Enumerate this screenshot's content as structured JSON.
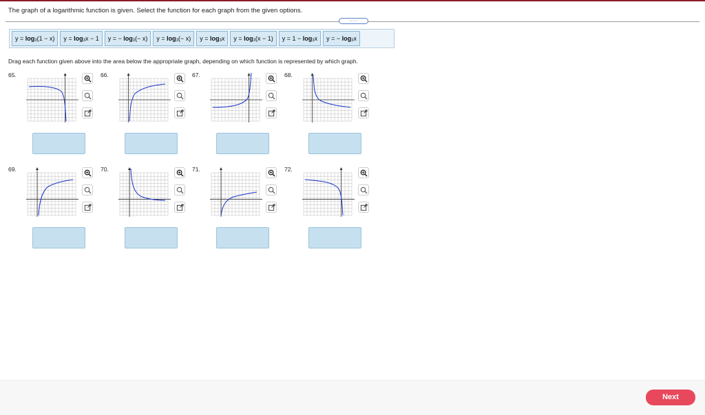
{
  "question": "The graph of a logarithmic function is given. Select the function for each graph from the given options.",
  "more_button": ".....",
  "options": [
    {
      "pre": "y = ",
      "log": "log",
      "base": "3",
      "arg": "(1 − x)",
      "post": ""
    },
    {
      "pre": "y = ",
      "log": "log",
      "base": "3",
      "arg": "x − 1",
      "post": ""
    },
    {
      "pre": "y = − ",
      "log": "log",
      "base": "3",
      "arg": "(− x)",
      "post": ""
    },
    {
      "pre": "y = ",
      "log": "log",
      "base": "3",
      "arg": "(− x)",
      "post": ""
    },
    {
      "pre": "y = ",
      "log": "log",
      "base": "3",
      "arg": "x",
      "post": ""
    },
    {
      "pre": "y = ",
      "log": "log",
      "base": "3",
      "arg": "(x − 1)",
      "post": ""
    },
    {
      "pre": "y = 1 − ",
      "log": "log",
      "base": "3",
      "arg": "x",
      "post": ""
    },
    {
      "pre": "y = − ",
      "log": "log",
      "base": "3",
      "arg": "x",
      "post": ""
    }
  ],
  "instructions": "Drag each function given above into the area below the appropriate graph, depending on which function is represented by which graph.",
  "graphs": [
    {
      "number": "65.",
      "curve": "a"
    },
    {
      "number": "66.",
      "curve": "b"
    },
    {
      "number": "67.",
      "curve": "c"
    },
    {
      "number": "68.",
      "curve": "d"
    },
    {
      "number": "69.",
      "curve": "e"
    },
    {
      "number": "70.",
      "curve": "f"
    },
    {
      "number": "71.",
      "curve": "g"
    },
    {
      "number": "72.",
      "curve": "h"
    }
  ],
  "tools": [
    "zoom-in-icon",
    "zoom-out-icon",
    "popout-icon"
  ],
  "next_label": "Next",
  "colors": {
    "accent": "#e8485c",
    "curve": "#1a35c9",
    "drop": "#c6e0ef",
    "option": "#d6e9f5"
  }
}
